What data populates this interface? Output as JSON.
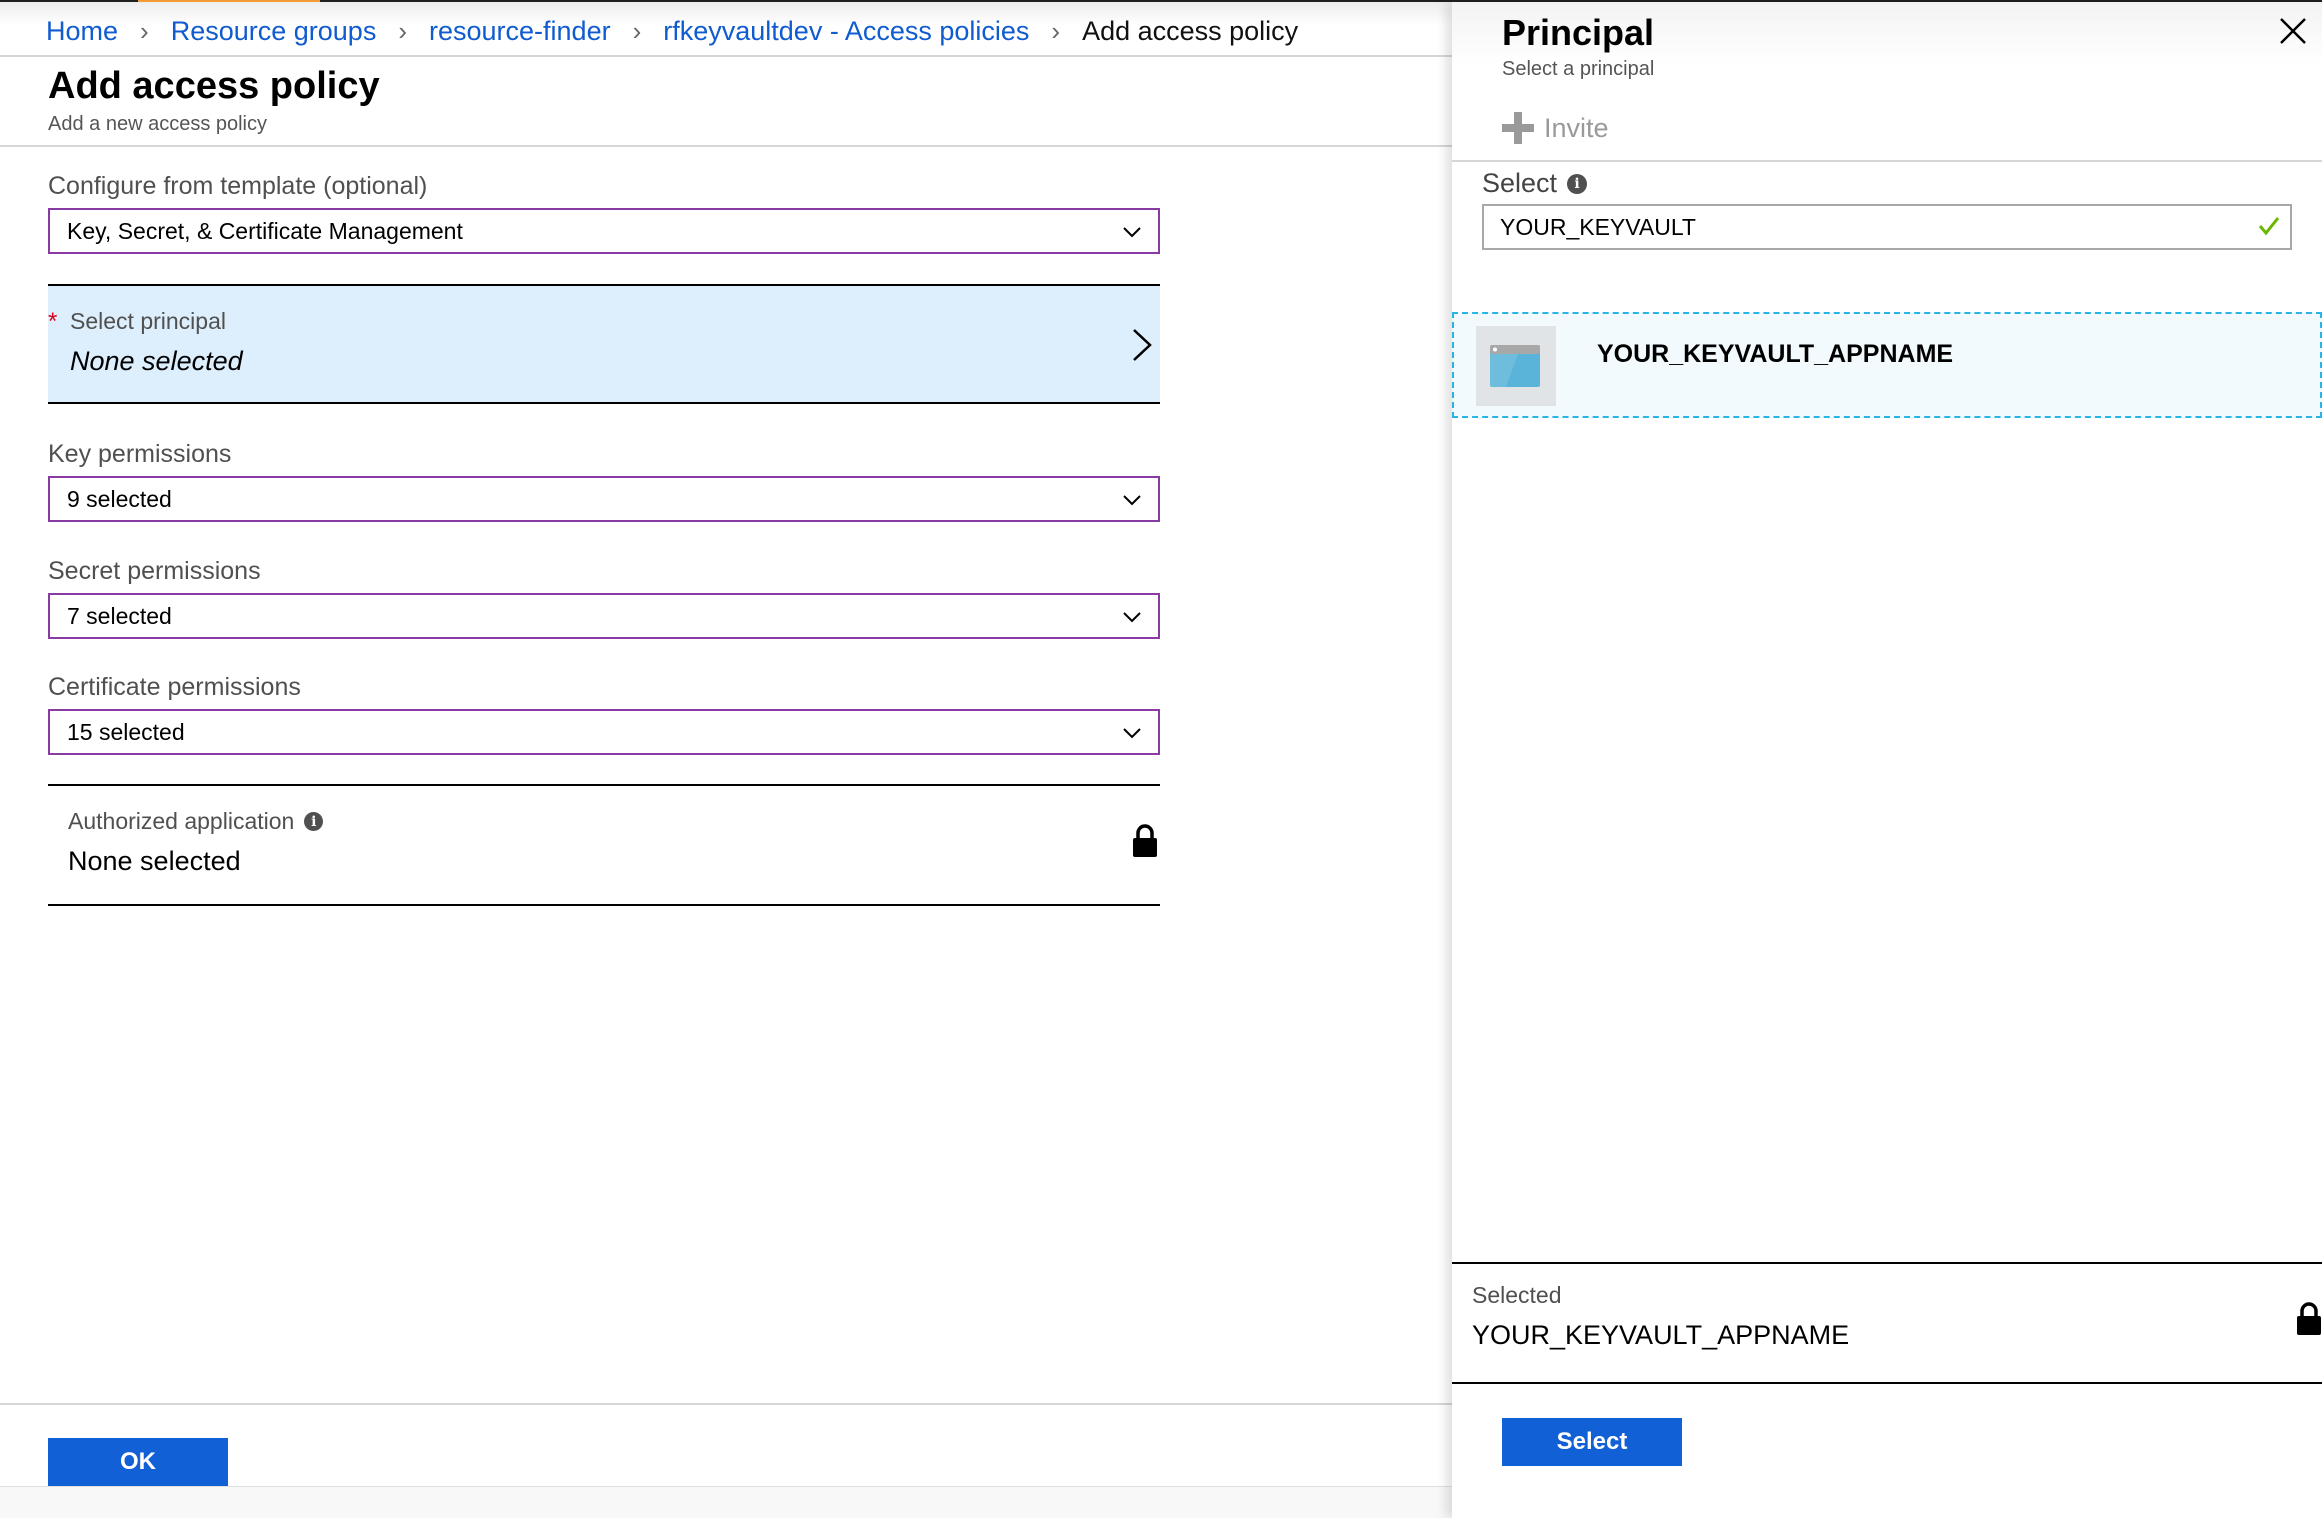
{
  "colors": {
    "accent_orange": "#f29c38",
    "link_blue": "#0f5bcf",
    "dropdown_border": "#8a3aa3",
    "principal_bg": "#ddeefc",
    "primary_button": "#1160d6",
    "result_border": "#28b4e4",
    "success_green": "#6bb700"
  },
  "breadcrumb": {
    "items": [
      "Home",
      "Resource groups",
      "resource-finder",
      "rfkeyvaultdev - Access policies"
    ],
    "current": "Add access policy",
    "separator": "›"
  },
  "blade": {
    "title": "Add access policy",
    "subtitle": "Add a new access policy"
  },
  "form": {
    "template": {
      "label": "Configure from template (optional)",
      "value": "Key, Secret, & Certificate Management"
    },
    "principal": {
      "required_mark": "*",
      "label": "Select principal",
      "value": "None selected"
    },
    "key_permissions": {
      "label": "Key permissions",
      "value": "9 selected"
    },
    "secret_permissions": {
      "label": "Secret permissions",
      "value": "7 selected"
    },
    "certificate_permissions": {
      "label": "Certificate permissions",
      "value": "15 selected"
    },
    "authorized_application": {
      "label": "Authorized application",
      "value": "None selected",
      "info_icon": "i"
    }
  },
  "footer": {
    "ok_label": "OK"
  },
  "panel": {
    "title": "Principal",
    "subtitle": "Select a principal",
    "invite_label": "Invite",
    "select_label": "Select",
    "info_icon": "i",
    "search_value": "YOUR_KEYVAULT",
    "results": [
      {
        "name": "YOUR_KEYVAULT_APPNAME",
        "icon": "app-registration-icon"
      }
    ],
    "selected_label": "Selected",
    "selected_value": "YOUR_KEYVAULT_APPNAME",
    "select_button_label": "Select"
  }
}
